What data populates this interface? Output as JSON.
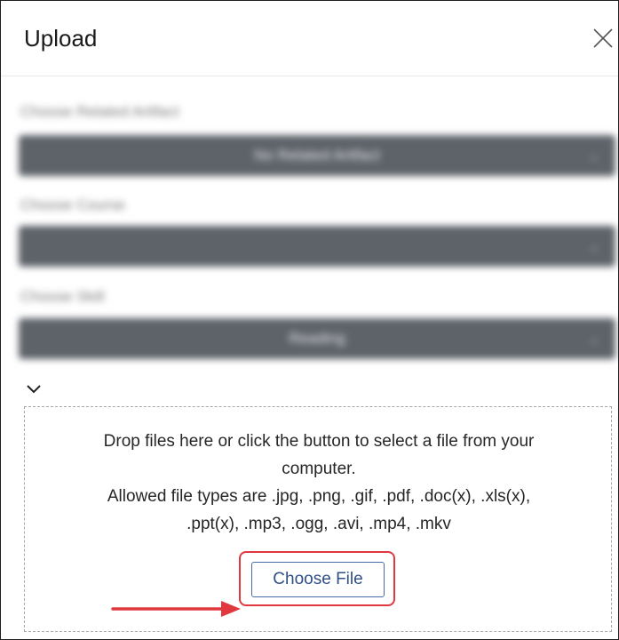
{
  "dialog": {
    "title": "Upload",
    "close_icon": "close-icon"
  },
  "blurred_form": {
    "related_artifact_label": "Choose Related Artifact",
    "related_artifact_value": "No Related Artifact",
    "course_label": "Choose Course",
    "course_value": "",
    "skill_label": "Choose Skill",
    "skill_value": "Reading"
  },
  "toggle": {
    "icon": "chevron-down-icon"
  },
  "dropzone": {
    "line1": "Drop files here or click the button to select a file from your",
    "line2": "computer.",
    "line3": "Allowed file types are .jpg, .png, .gif, .pdf, .doc(x), .xls(x),",
    "line4": ".ppt(x), .mp3, .ogg, .avi, .mp4, .mkv",
    "choose_file_label": "Choose File"
  },
  "annotation": {
    "arrow_icon": "arrow-right-icon",
    "highlight_color": "#e0383e"
  }
}
